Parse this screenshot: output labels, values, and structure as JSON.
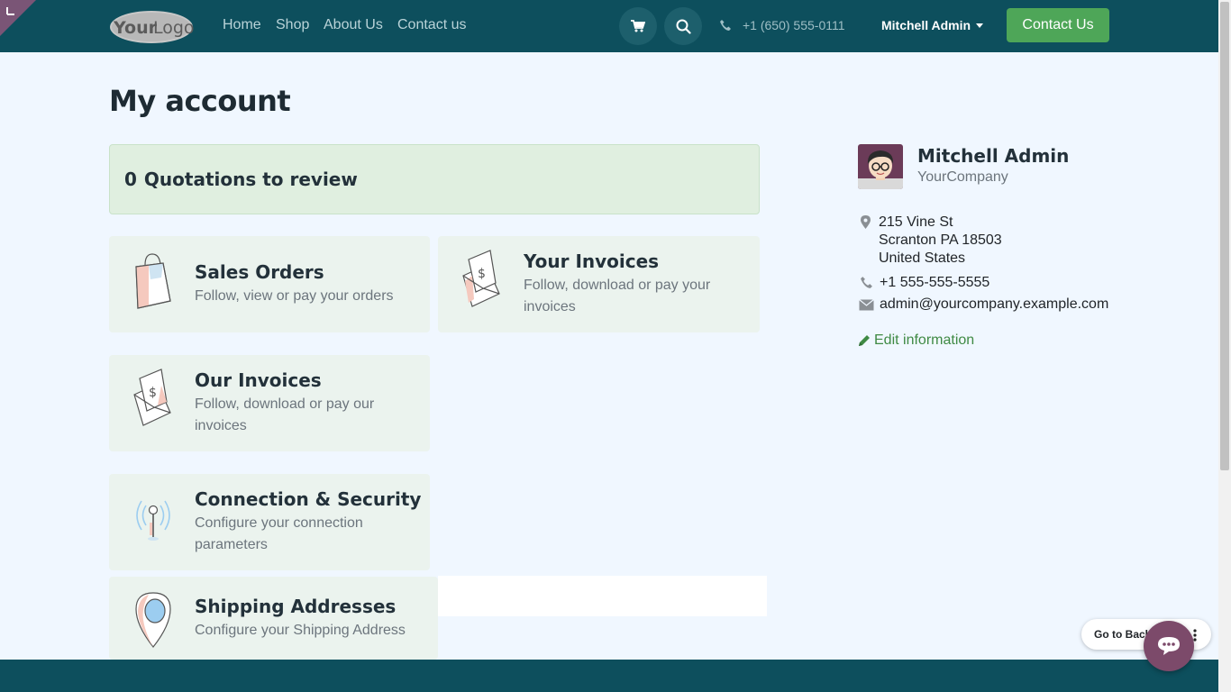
{
  "header": {
    "logo_alt": "YourLogo",
    "nav": [
      "Home",
      "Shop",
      "About Us",
      "Contact us"
    ],
    "phone": "+1 (650) 555-0111",
    "user": "Mitchell Admin",
    "cta": "Contact Us"
  },
  "page": {
    "title": "My account"
  },
  "alert": {
    "count": "0",
    "label": "Quotations to review"
  },
  "cards": [
    {
      "title": "Sales Orders",
      "desc": "Follow, view or pay your orders"
    },
    {
      "title": "Your Invoices",
      "desc": "Follow, download or pay your invoices"
    },
    {
      "title": "Our Invoices",
      "desc": "Follow, download or pay our invoices"
    },
    {
      "title": "Connection & Security",
      "desc": "Configure your connection parameters"
    },
    {
      "title": "Shipping Addresses",
      "desc": "Configure your Shipping Address"
    }
  ],
  "profile": {
    "name": "Mitchell Admin",
    "company": "YourCompany",
    "address": [
      "215 Vine St",
      "Scranton PA 18503",
      "United States"
    ],
    "phone": "+1 555-555-5555",
    "email": "admin@yourcompany.example.com",
    "edit": "Edit information"
  },
  "backend": {
    "label": "Go to Backend"
  },
  "colors": {
    "header": "#0d4f5d",
    "accent": "#4ea658",
    "link": "#3f8a44",
    "chat": "#7c4a6a"
  }
}
